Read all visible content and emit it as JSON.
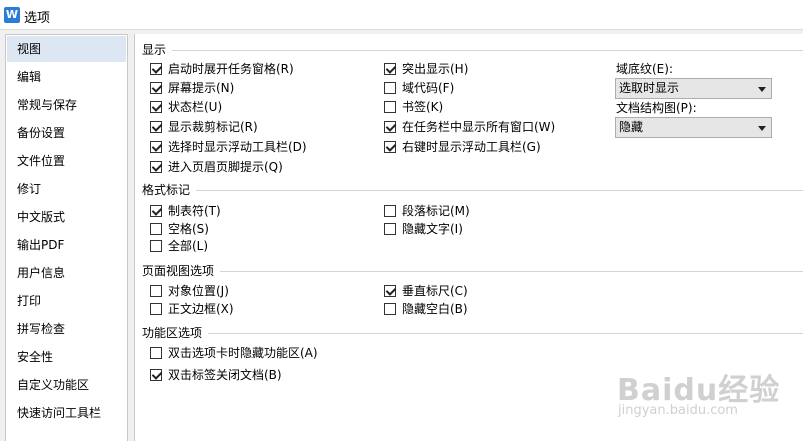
{
  "window": {
    "title": "选项",
    "app_icon_letter": "W"
  },
  "sidebar": {
    "items": [
      {
        "label": "视图",
        "active": true
      },
      {
        "label": "编辑"
      },
      {
        "label": "常规与保存"
      },
      {
        "label": "备份设置"
      },
      {
        "label": "文件位置"
      },
      {
        "label": "修订"
      },
      {
        "label": "中文版式"
      },
      {
        "label": "输出PDF"
      },
      {
        "label": "用户信息"
      },
      {
        "label": "打印"
      },
      {
        "label": "拼写检查"
      },
      {
        "label": "安全性"
      },
      {
        "label": "自定义功能区"
      },
      {
        "label": "快速访问工具栏"
      }
    ]
  },
  "display": {
    "title": "显示",
    "left": [
      {
        "label": "启动时展开任务窗格(R)",
        "checked": true
      },
      {
        "label": "屏幕提示(N)",
        "checked": true
      },
      {
        "label": "状态栏(U)",
        "checked": true
      },
      {
        "label": "显示裁剪标记(R)",
        "checked": true
      },
      {
        "label": "选择时显示浮动工具栏(D)",
        "checked": true
      },
      {
        "label": "进入页眉页脚提示(Q)",
        "checked": true
      }
    ],
    "right": [
      {
        "label": "突出显示(H)",
        "checked": true
      },
      {
        "label": "域代码(F)",
        "checked": false
      },
      {
        "label": "书签(K)",
        "checked": false
      },
      {
        "label": "在任务栏中显示所有窗口(W)",
        "checked": true
      },
      {
        "label": "右键时显示浮动工具栏(G)",
        "checked": true
      }
    ],
    "field_shading": {
      "label": "域底纹(E):",
      "value": "选取时显示"
    },
    "doc_map": {
      "label": "文档结构图(P):",
      "value": "隐藏"
    }
  },
  "format_marks": {
    "title": "格式标记",
    "left": [
      {
        "label": "制表符(T)",
        "checked": true
      },
      {
        "label": "空格(S)",
        "checked": false
      },
      {
        "label": "全部(L)",
        "checked": false
      }
    ],
    "right": [
      {
        "label": "段落标记(M)",
        "checked": false
      },
      {
        "label": "隐藏文字(I)",
        "checked": false
      }
    ]
  },
  "page_view": {
    "title": "页面视图选项",
    "left": [
      {
        "label": "对象位置(J)",
        "checked": false
      },
      {
        "label": "正文边框(X)",
        "checked": false
      }
    ],
    "right": [
      {
        "label": "垂直标尺(C)",
        "checked": true
      },
      {
        "label": "隐藏空白(B)",
        "checked": false
      }
    ]
  },
  "ribbon": {
    "title": "功能区选项",
    "items": [
      {
        "label": "双击选项卡时隐藏功能区(A)",
        "checked": false
      },
      {
        "label": "双击标签关闭文档(B)",
        "checked": true
      }
    ]
  },
  "watermark": {
    "brand": "Baidu经验",
    "url": "jingyan.baidu.com"
  }
}
